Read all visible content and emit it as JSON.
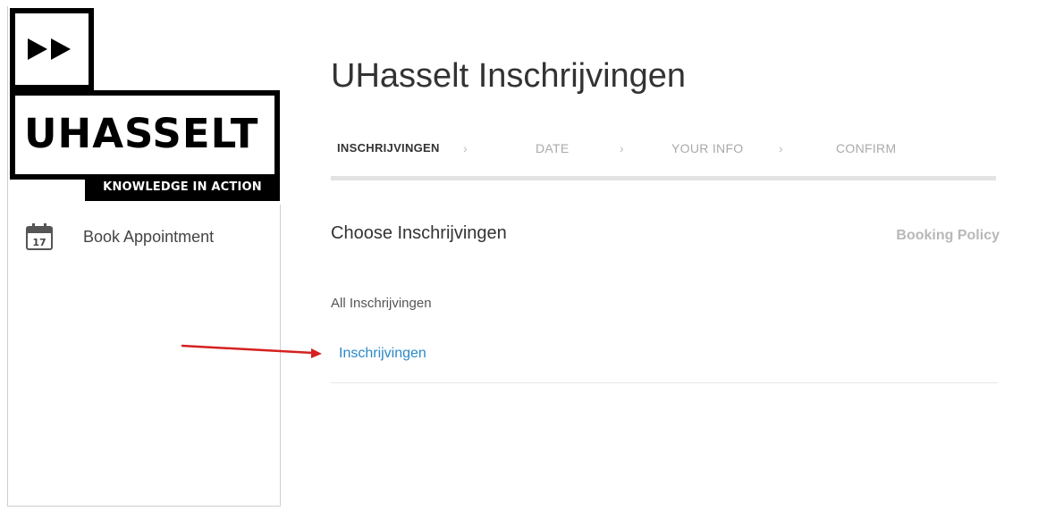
{
  "sidebar": {
    "logo": {
      "wordmark": "UHASSELT",
      "tagline": "KNOWLEDGE IN ACTION"
    },
    "items": [
      {
        "label": "Book Appointment",
        "icon": "calendar-icon",
        "icon_day": "17"
      }
    ]
  },
  "main": {
    "title": "UHasselt Inschrijvingen",
    "steps": [
      {
        "label": "INSCHRIJVINGEN",
        "active": true
      },
      {
        "label": "DATE",
        "active": false
      },
      {
        "label": "YOUR INFO",
        "active": false
      },
      {
        "label": "CONFIRM",
        "active": false
      }
    ],
    "step_separator": "›",
    "section_title": "Choose Inschrijvingen",
    "booking_policy": "Booking Policy",
    "category_label": "All Inschrijvingen",
    "services": [
      {
        "label": "Inschrijvingen"
      }
    ]
  },
  "colors": {
    "link": "#2a88c8",
    "annotation_arrow": "#d62020",
    "logo_black": "#000000"
  }
}
